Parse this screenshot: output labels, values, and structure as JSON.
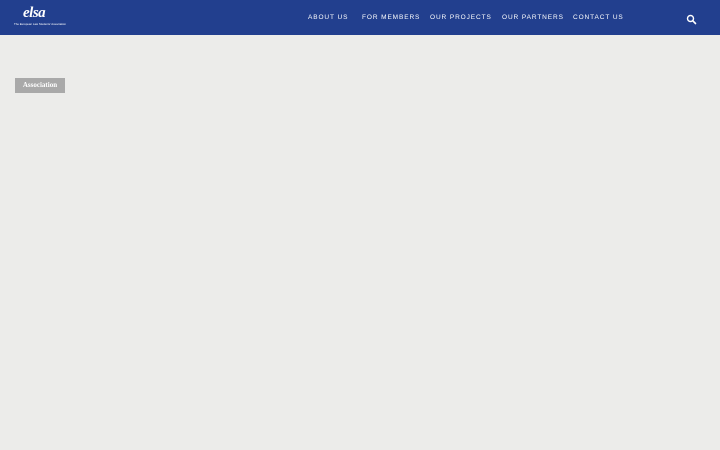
{
  "header": {
    "logo": {
      "wordmark": "elsa",
      "tagline": "The European Law Students' Association"
    },
    "nav": [
      {
        "label": "ABOUT US"
      },
      {
        "label": "FOR MEMBERS"
      },
      {
        "label": "OUR PROJECTS"
      },
      {
        "label": "OUR PARTNERS"
      },
      {
        "label": "CONTACT US"
      }
    ],
    "search_icon": "search-icon"
  },
  "main": {
    "tag_label": "Association"
  },
  "colors": {
    "header_bg": "#223f8e",
    "page_bg": "#ececea",
    "tag_bg": "#a9a9a9",
    "text_light": "#ffffff"
  }
}
